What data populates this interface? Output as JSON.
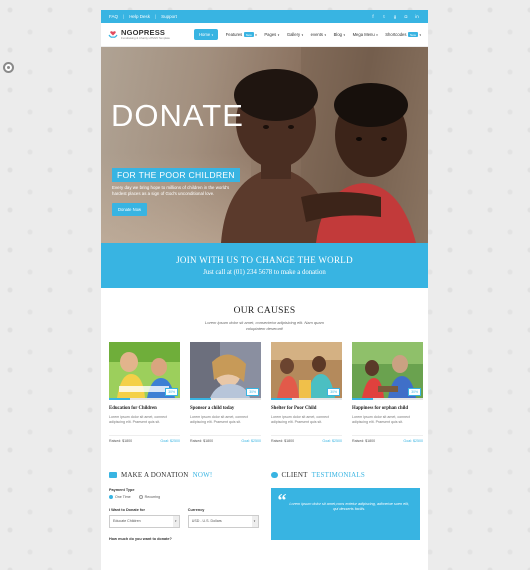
{
  "topbar": {
    "links": [
      "FAQ",
      "Help Desk",
      "Support"
    ],
    "socials": [
      "facebook-icon",
      "twitter-icon",
      "google-plus-icon",
      "instagram-icon",
      "linkedin-icon"
    ]
  },
  "logo": {
    "name": "NGOPRESS",
    "tagline": "Fundraising & Charity HTML5 Template"
  },
  "menu": {
    "items": [
      {
        "label": "Home",
        "active": true
      },
      {
        "label": "Features",
        "badge": "New"
      },
      {
        "label": "Pages"
      },
      {
        "label": "Gallery"
      },
      {
        "label": "events"
      },
      {
        "label": "Blog"
      },
      {
        "label": "Mega Menu"
      },
      {
        "label": "Shortcodes",
        "badge": "New"
      }
    ]
  },
  "hero": {
    "title": "DONATE",
    "subtitle": "FOR THE POOR CHILDREN",
    "text": "Every day we bring hope to millions of children in the world's hardest places as a sign of God's unconditional love.",
    "button": "Donate Now"
  },
  "join": {
    "title": "JOIN WITH US TO CHANGE THE WORLD",
    "subtitle": "Just call at (01) 234 5678 to make a donation"
  },
  "causes": {
    "title": "OUR CAUSES",
    "intro_line1": "Lorem ipsum dolor sit amet, consectetur adipisicing elit. Nam quam",
    "intro_line2": "voluptatem deserunt!",
    "items": [
      {
        "title": "Education for Children",
        "desc": "Lorem ipsum dolor sit amet, connect adipiscing elit. Praesent quis sit.",
        "raised": "Raised: $1800",
        "goal": "Goal: $2500",
        "percent": "30%",
        "progress": 0.3
      },
      {
        "title": "Sponsor a child today",
        "desc": "Lorem ipsum dolor sit amet, connect adipiscing elit. Praesent quis sit.",
        "raised": "Raised: $1800",
        "goal": "Goal: $2500",
        "percent": "30%",
        "progress": 0.3
      },
      {
        "title": "Shelter for Poor Child",
        "desc": "Lorem ipsum dolor sit amet, connect adipiscing elit. Praesent quis sit.",
        "raised": "Raised: $1800",
        "goal": "Goal: $2500",
        "percent": "30%",
        "progress": 0.3
      },
      {
        "title": "Happiness for orphan child",
        "desc": "Lorem ipsum dolor sit amet, connect adipiscing elit. Praesent quis sit.",
        "raised": "Raised: $1800",
        "goal": "Goal: $2500",
        "percent": "30%",
        "progress": 0.3
      }
    ]
  },
  "donation": {
    "heading": "MAKE A DONATION",
    "heading_highlight": "NOW!",
    "payment_type_label": "Payment Type",
    "one_time": "One Time",
    "recurring": "Recurring",
    "donate_for_label": "I Want to Donate for",
    "donate_for_value": "Educate Children",
    "currency_label": "Currency",
    "currency_value": "USD - U.S. Dollars",
    "amount_label": "How much do you want to donate?"
  },
  "testimonials": {
    "heading": "CLIENT",
    "heading_highlight": "TESTIMONIALS",
    "quote": "Lorem ipsum dolor sit amet,cons ectetur adipiscing, adhnetue suen elit, qui desserts facilis."
  },
  "colors": {
    "accent": "#38b4e2"
  }
}
